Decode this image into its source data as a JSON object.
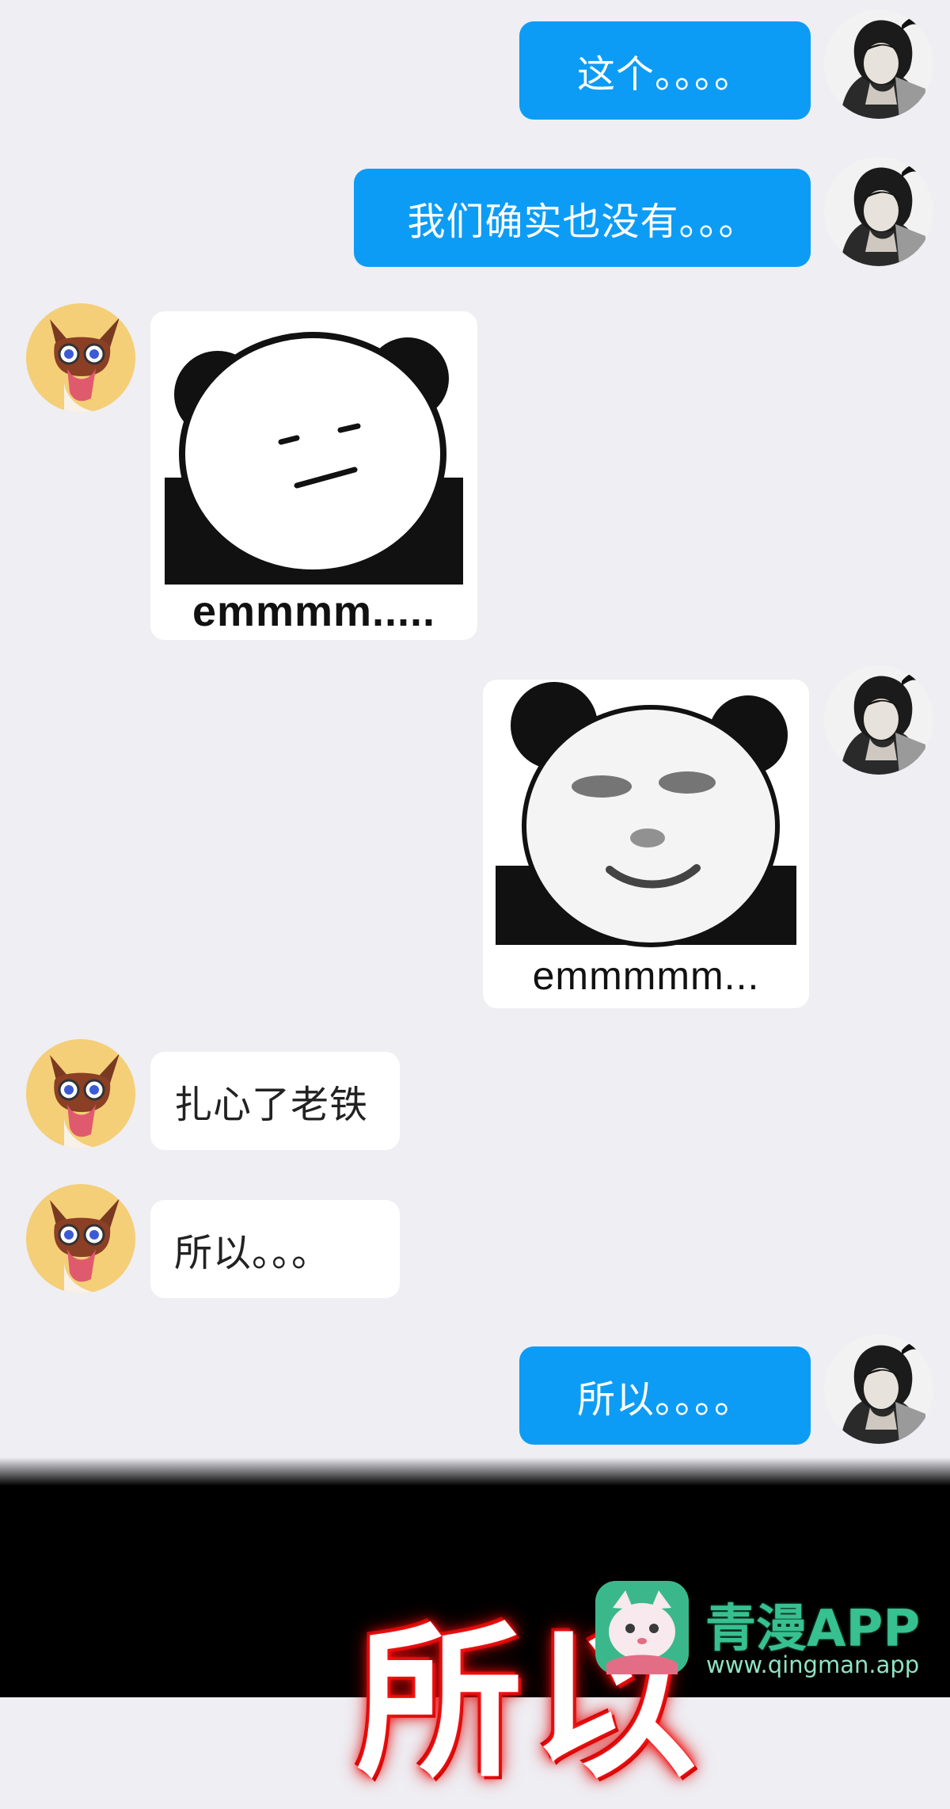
{
  "messages": {
    "m1_text": "这个。。。。",
    "m2_text": "我们确实也没有。。。",
    "m3_caption": "emmmm.....",
    "m4_caption": "emmmmm...",
    "m5_text": "扎心了老铁",
    "m6_text": "所以。。。",
    "m7_text": "所以。。。。"
  },
  "overlay": {
    "big_text": "所以"
  },
  "watermark": {
    "title": "青漫APP",
    "url": "www.qingman.app"
  },
  "colors": {
    "outgoing_bubble": "#0d9cf5",
    "incoming_bubble": "#ffffff",
    "background": "#eeeef3",
    "watermark_green": "#37c090"
  }
}
